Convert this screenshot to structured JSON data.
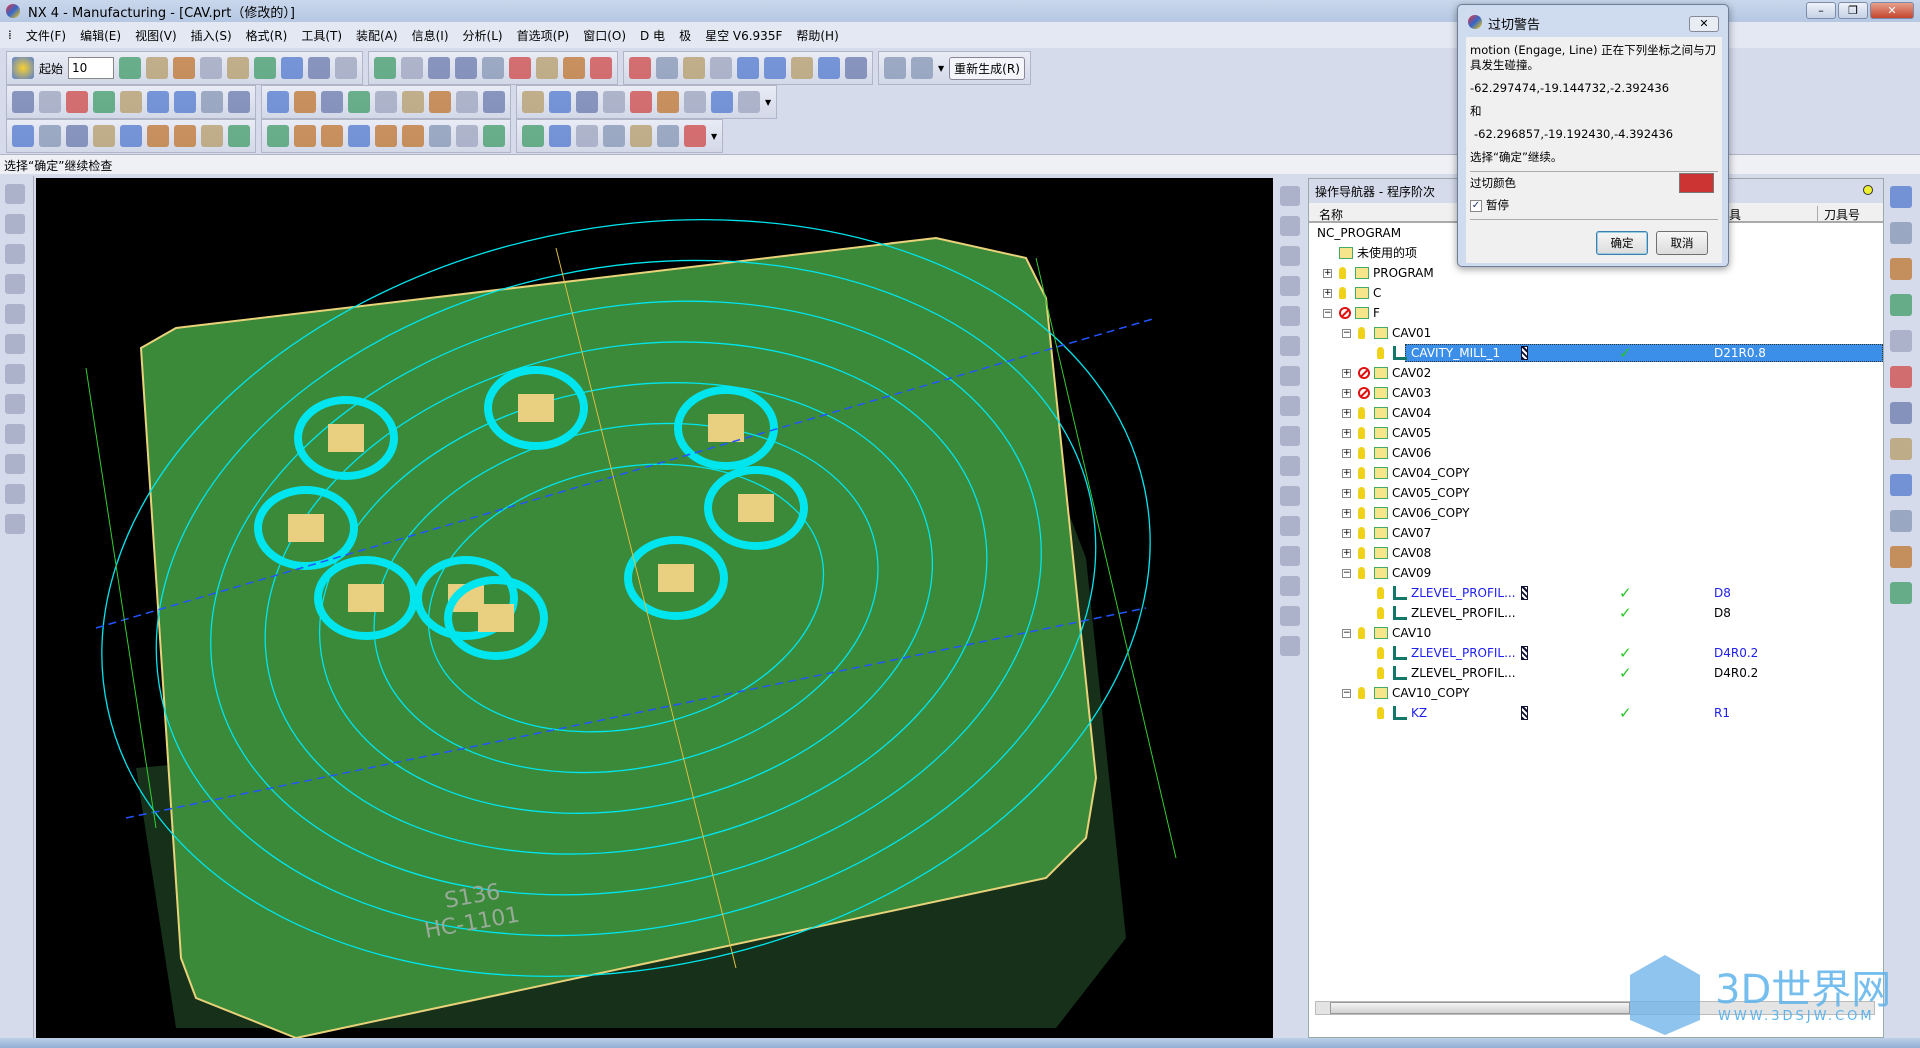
{
  "window": {
    "title": "NX 4 - Manufacturing - [CAV.prt（修改的）]"
  },
  "menu": [
    "文件(F)",
    "编辑(E)",
    "视图(V)",
    "插入(S)",
    "格式(R)",
    "工具(T)",
    "装配(A)",
    "信息(I)",
    "分析(L)",
    "首选项(P)",
    "窗口(O)",
    "D 电",
    "极",
    "星空 V6.935F",
    "帮助(H)"
  ],
  "toolbar": {
    "start_label": "起始",
    "layer_value": "10",
    "regenerate_label": "重新生成(R)"
  },
  "status_line": "选择“确定”继续检查",
  "navigator": {
    "title": "操作导航器 - 程序阶次",
    "columns": [
      "名称",
      "刀具",
      "刀具号"
    ],
    "rows": [
      {
        "level": 0,
        "name": "NC_PROGRAM",
        "kind": "root"
      },
      {
        "level": 1,
        "name": "未使用的项",
        "kind": "folder",
        "expand": ""
      },
      {
        "level": 1,
        "name": "PROGRAM",
        "kind": "folder",
        "expand": "+",
        "status": "ok"
      },
      {
        "level": 1,
        "name": "C",
        "kind": "folder",
        "expand": "+",
        "status": "ok"
      },
      {
        "level": 1,
        "name": "F",
        "kind": "folder",
        "expand": "-",
        "status": "stop"
      },
      {
        "level": 2,
        "name": "CAV01",
        "kind": "folder",
        "expand": "-",
        "status": "ok"
      },
      {
        "level": 3,
        "name": "CAVITY_MILL_1",
        "kind": "op",
        "status": "ok",
        "selected": true,
        "blue": true,
        "tool_icon": true,
        "check": "✓",
        "tool": "D21R0.8"
      },
      {
        "level": 2,
        "name": "CAV02",
        "kind": "folder",
        "expand": "+",
        "status": "stop"
      },
      {
        "level": 2,
        "name": "CAV03",
        "kind": "folder",
        "expand": "+",
        "status": "stop"
      },
      {
        "level": 2,
        "name": "CAV04",
        "kind": "folder",
        "expand": "+",
        "status": "ok"
      },
      {
        "level": 2,
        "name": "CAV05",
        "kind": "folder",
        "expand": "+",
        "status": "ok"
      },
      {
        "level": 2,
        "name": "CAV06",
        "kind": "folder",
        "expand": "+",
        "status": "ok"
      },
      {
        "level": 2,
        "name": "CAV04_COPY",
        "kind": "folder",
        "expand": "+",
        "status": "ok"
      },
      {
        "level": 2,
        "name": "CAV05_COPY",
        "kind": "folder",
        "expand": "+",
        "status": "ok"
      },
      {
        "level": 2,
        "name": "CAV06_COPY",
        "kind": "folder",
        "expand": "+",
        "status": "ok"
      },
      {
        "level": 2,
        "name": "CAV07",
        "kind": "folder",
        "expand": "+",
        "status": "ok"
      },
      {
        "level": 2,
        "name": "CAV08",
        "kind": "folder",
        "expand": "+",
        "status": "ok"
      },
      {
        "level": 2,
        "name": "CAV09",
        "kind": "folder",
        "expand": "-",
        "status": "ok"
      },
      {
        "level": 3,
        "name": "ZLEVEL_PROFIL...",
        "kind": "op",
        "status": "ok",
        "blue": true,
        "tool_icon": true,
        "check": "✓",
        "tool": "D8"
      },
      {
        "level": 3,
        "name": "ZLEVEL_PROFIL...",
        "kind": "op",
        "status": "ok",
        "check": "✓",
        "tool": "D8"
      },
      {
        "level": 2,
        "name": "CAV10",
        "kind": "folder",
        "expand": "-",
        "status": "ok"
      },
      {
        "level": 3,
        "name": "ZLEVEL_PROFIL...",
        "kind": "op",
        "status": "ok",
        "blue": true,
        "tool_icon": true,
        "check": "✓",
        "tool": "D4R0.2"
      },
      {
        "level": 3,
        "name": "ZLEVEL_PROFIL...",
        "kind": "op",
        "status": "ok",
        "check": "✓",
        "tool": "D4R0.2"
      },
      {
        "level": 2,
        "name": "CAV10_COPY",
        "kind": "folder",
        "expand": "-",
        "status": "ok"
      },
      {
        "level": 3,
        "name": "KZ",
        "kind": "op",
        "status": "ok",
        "blue": true,
        "tool_icon": true,
        "check": "✓",
        "tool": "R1"
      }
    ]
  },
  "dialog": {
    "title": "过切警告",
    "message": "motion (Engage, Line) 正在下列坐标之间与刀具发生碰撞。",
    "coord1": "-62.297474,-19.144732,-2.392436",
    "and": "和",
    "coord2": "-62.296857,-19.192430,-4.392436",
    "prompt": "选择“确定”继续。",
    "color_label": "过切颜色",
    "gouge_color": "#cc3333",
    "pause_label": "暂停",
    "pause_checked": true,
    "ok_label": "确定",
    "cancel_label": "取消"
  },
  "viewport": {
    "engraving1": "S136",
    "engraving2": "HC-1101",
    "plate_color": "#3a8a3a",
    "toolpath_color": "#00e5ee"
  },
  "watermark": {
    "brand": "3D世界网",
    "url": "WWW.3DSJW.COM"
  },
  "icons": {
    "row1": [
      "new",
      "open",
      "save",
      "fit",
      "zoom-window",
      "zoom",
      "shaded",
      "wireframe",
      "edge",
      "static-wireframe",
      "layer-settings",
      "layer-visible",
      "work-layer",
      "move-layer",
      "wcs-dynamic",
      "wcs-origin",
      "wcs-rotate",
      "wcs-orient",
      "wcs-set",
      "wcs-save",
      "display-wcs",
      "select-filter",
      "create-program",
      "create-tool",
      "create-geometry",
      "create-method",
      "create-operation",
      "measure-distance",
      "measure-angle"
    ],
    "row2": [
      "sketch",
      "dimension",
      "extrude",
      "arrow-left",
      "arrow-right",
      "transform",
      "offset",
      "boss",
      "pocket",
      "block",
      "hole",
      "blend",
      "chamfer",
      "shell",
      "draft",
      "split",
      "trim",
      "pad",
      "rectangle",
      "polygon",
      "datum-csys",
      "point",
      "circle-tool",
      "sweep",
      "face",
      "solid",
      "circle"
    ],
    "row3": [
      "generate",
      "replay",
      "toolpath",
      "verify",
      "list",
      "postprocess",
      "shop-doc",
      "output-cls",
      "ipw",
      "simulate",
      "edit",
      "attribute",
      "note",
      "pen",
      "material",
      "page",
      "mesh",
      "property",
      "print",
      "refresh",
      "cylinder",
      "calculator",
      "clock",
      "feed",
      "speed"
    ]
  }
}
